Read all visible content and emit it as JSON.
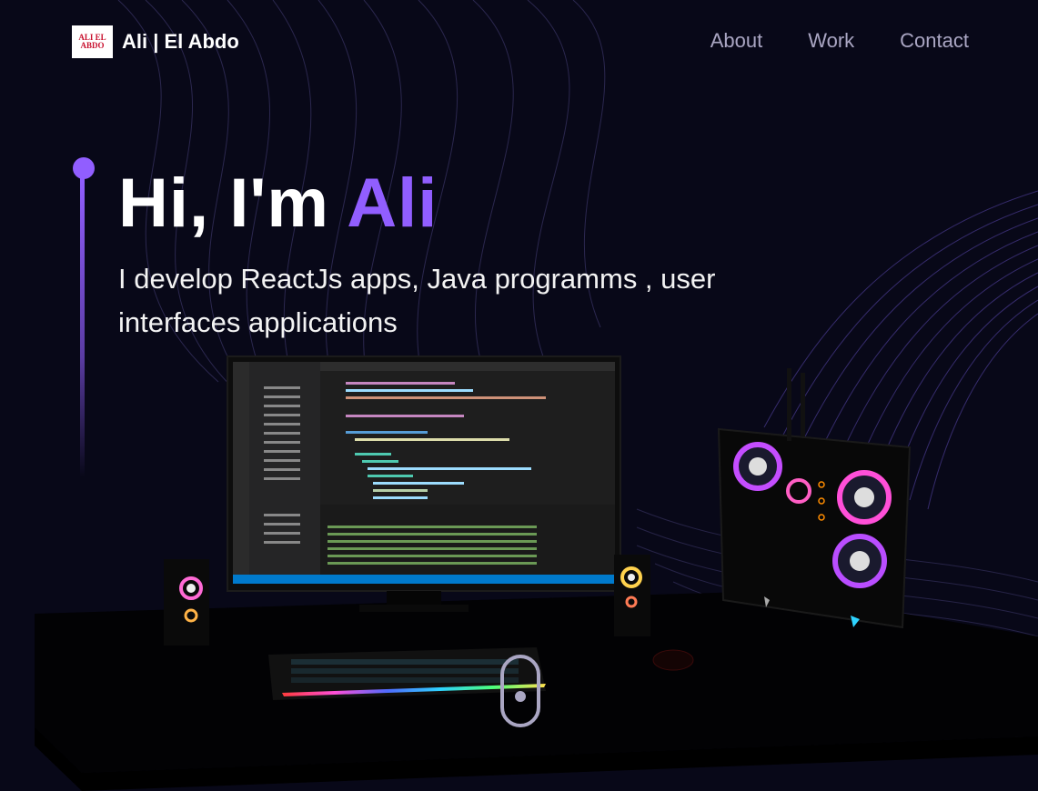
{
  "nav": {
    "logo_line1": "ALI EL",
    "logo_line2": "ABDO",
    "brand_first": "Ali",
    "brand_rest": " | El Abdo",
    "links": [
      {
        "label": "About"
      },
      {
        "label": "Work"
      },
      {
        "label": "Contact"
      }
    ]
  },
  "hero": {
    "greeting": "Hi, I'm ",
    "name": "Ali",
    "subtitle": "I develop ReactJs apps, Java programms , user interfaces applications"
  },
  "colors": {
    "accent": "#915eff",
    "background": "#080818",
    "nav_link": "#aaa6c3"
  },
  "scene": {
    "description_icons": [
      "desk-scene",
      "monitor",
      "keyboard",
      "pc-tower",
      "speaker"
    ]
  }
}
